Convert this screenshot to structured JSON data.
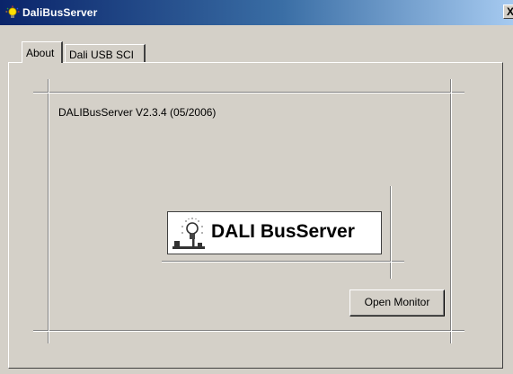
{
  "window": {
    "title": "DaliBusServer",
    "close_label": "X",
    "title_icon": "bulb-icon"
  },
  "tabs": [
    {
      "label": "About",
      "active": true
    },
    {
      "label": "Dali USB SCI",
      "active": false
    }
  ],
  "about": {
    "version_text": "DALIBusServer V2.3.4 (05/2006)",
    "logo_text": "DALI BusServer",
    "logo_icon": "lamp-network-icon",
    "open_monitor_label": "Open Monitor"
  },
  "colors": {
    "titlebar_start": "#0a246a",
    "titlebar_end": "#a6caf0",
    "face": "#d4d0c8"
  }
}
